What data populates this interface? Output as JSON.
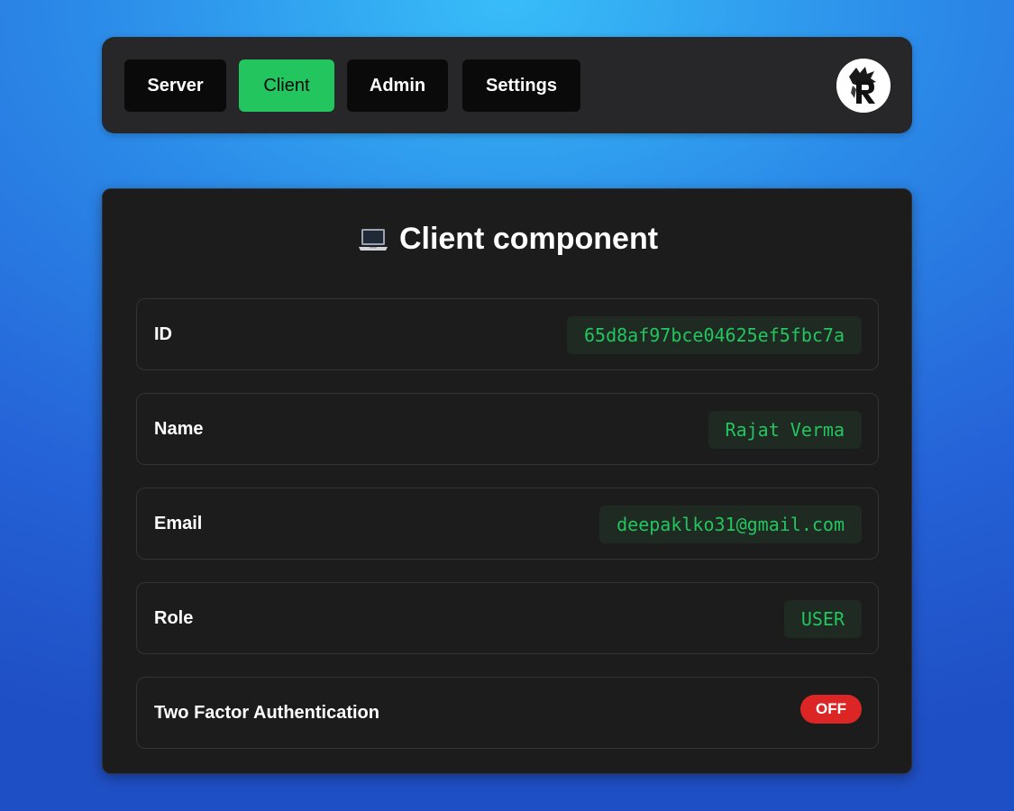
{
  "navbar": {
    "tabs": [
      {
        "label": "Server",
        "active": false
      },
      {
        "label": "Client",
        "active": true
      },
      {
        "label": "Admin",
        "active": false
      },
      {
        "label": "Settings",
        "active": false
      }
    ],
    "avatar_icon": "lion-r-logo-icon"
  },
  "card": {
    "title_icon": "laptop-icon",
    "title": "Client component",
    "rows": [
      {
        "label": "ID",
        "value": "65d8af97bce04625ef5fbc7a"
      },
      {
        "label": "Name",
        "value": "Rajat Verma"
      },
      {
        "label": "Email",
        "value": "deepaklko31@gmail.com"
      },
      {
        "label": "Role",
        "value": "USER"
      },
      {
        "label": "Two Factor Authentication",
        "value": "OFF"
      }
    ]
  },
  "colors": {
    "active_tab": "#22c55e",
    "value_text": "#22c55e",
    "off_badge": "#dc2626",
    "panel_bg": "#27272a",
    "card_bg": "#1c1c1c"
  }
}
